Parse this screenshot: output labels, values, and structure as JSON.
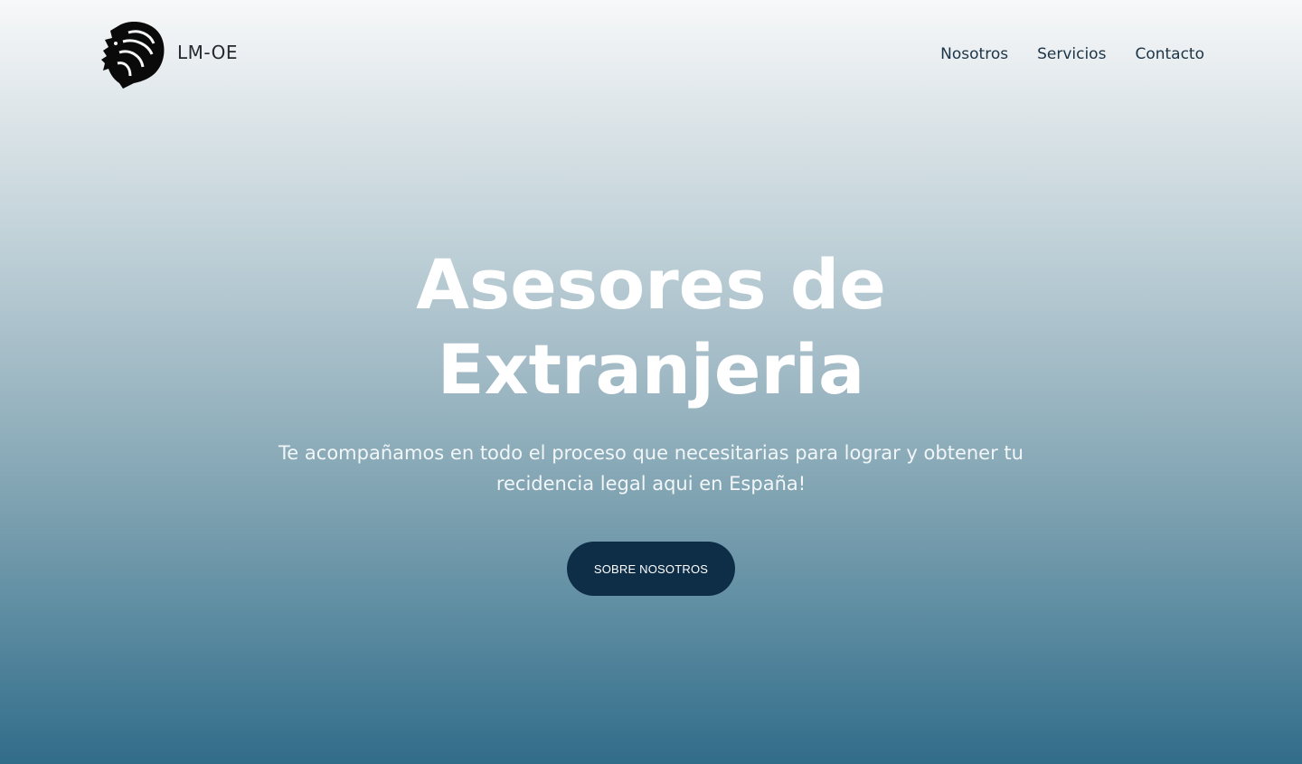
{
  "header": {
    "logo_icon": "lion-head-icon",
    "brand": "LM-OE",
    "nav": [
      {
        "label": "Nosotros"
      },
      {
        "label": "Servicios"
      },
      {
        "label": "Contacto"
      }
    ]
  },
  "hero": {
    "title_line1": "Asesores de",
    "title_line2": "Extranjeria",
    "subtitle_line1": "Te acompañamos en todo el proceso que necesitarias para lograr y obtener tu",
    "subtitle_line2": "recidencia legal aqui en España!",
    "cta_label": "SOBRE NOSOTROS"
  },
  "colors": {
    "gradient_top": "#f7f8f9",
    "gradient_bottom": "#316c89",
    "button_bg": "#0e2d47",
    "nav_text": "#1c3447"
  }
}
